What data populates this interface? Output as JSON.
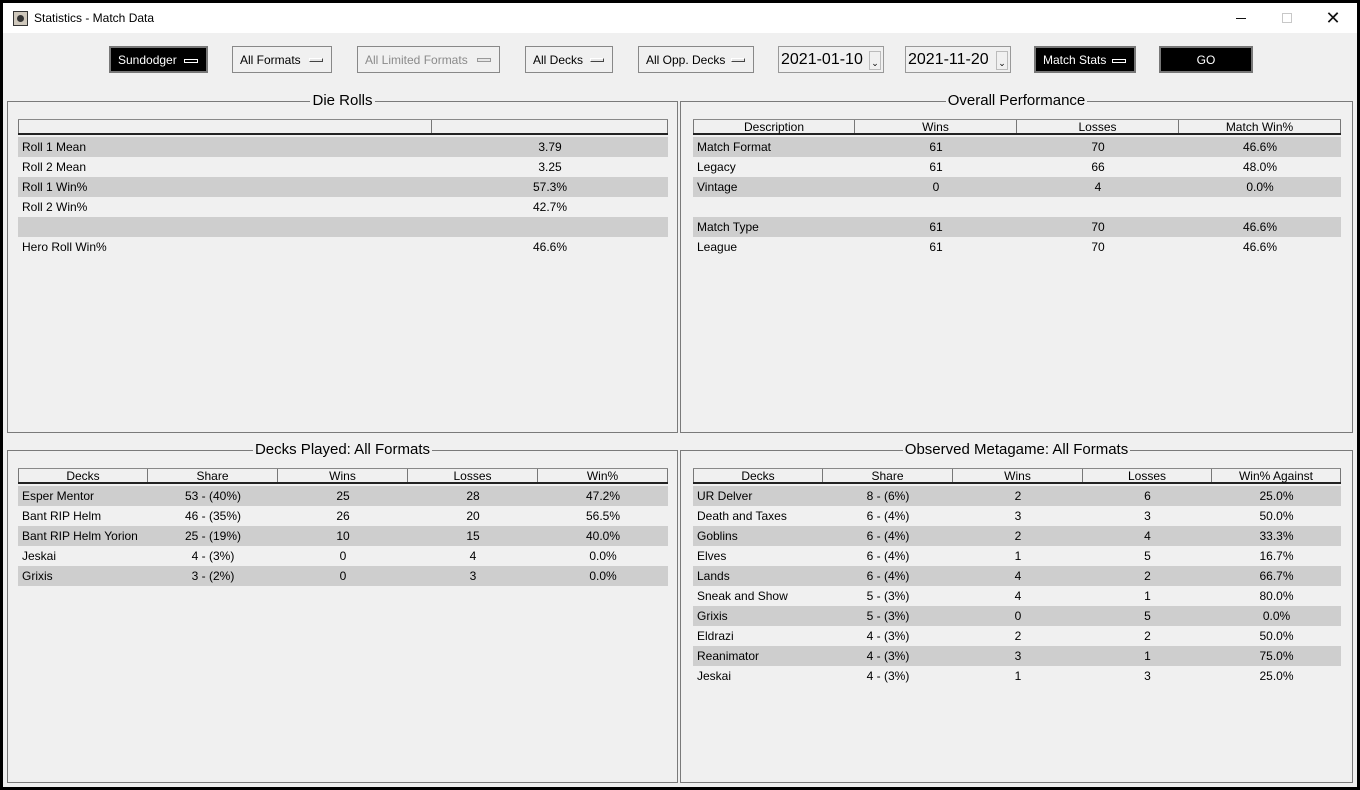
{
  "window": {
    "title": "Statistics - Match Data",
    "minimize_icon": "minimize-icon",
    "maximize_icon": "maximize-icon",
    "close_icon": "close-icon"
  },
  "toolbar": {
    "player": "Sundodger",
    "format": "All Formats",
    "limited_format": "All Limited Formats",
    "deck": "All Decks",
    "opp_deck": "All Opp. Decks",
    "date_from": "2021-01-10",
    "date_to": "2021-11-20",
    "date_arrow": "⌄",
    "stat_type": "Match Stats",
    "go_label": "GO"
  },
  "die_rolls": {
    "title": "Die Rolls",
    "headers": [
      "",
      ""
    ],
    "rows": [
      [
        "Roll 1 Mean",
        "3.79"
      ],
      [
        "Roll 2 Mean",
        "3.25"
      ],
      [
        "Roll 1 Win%",
        "57.3%"
      ],
      [
        "Roll 2 Win%",
        "42.7%"
      ],
      [
        "",
        ""
      ],
      [
        "Hero Roll Win%",
        "46.6%"
      ]
    ]
  },
  "overall": {
    "title": "Overall Performance",
    "headers": [
      "Description",
      "Wins",
      "Losses",
      "Match Win%"
    ],
    "rows": [
      [
        "Match Format",
        "61",
        "70",
        "46.6%"
      ],
      [
        "Legacy",
        "61",
        "66",
        "48.0%"
      ],
      [
        "Vintage",
        "0",
        "4",
        "0.0%"
      ],
      [
        "",
        "",
        "",
        ""
      ],
      [
        "Match Type",
        "61",
        "70",
        "46.6%"
      ],
      [
        "League",
        "61",
        "70",
        "46.6%"
      ]
    ]
  },
  "decks_played": {
    "title": "Decks Played: All Formats",
    "headers": [
      "Decks",
      "Share",
      "Wins",
      "Losses",
      "Win%"
    ],
    "rows": [
      [
        "Esper Mentor",
        "53 - (40%)",
        "25",
        "28",
        "47.2%"
      ],
      [
        "Bant RIP Helm",
        "46 - (35%)",
        "26",
        "20",
        "56.5%"
      ],
      [
        "Bant RIP Helm Yorion",
        "25 - (19%)",
        "10",
        "15",
        "40.0%"
      ],
      [
        "Jeskai",
        "4 - (3%)",
        "0",
        "4",
        "0.0%"
      ],
      [
        "Grixis",
        "3 - (2%)",
        "0",
        "3",
        "0.0%"
      ]
    ]
  },
  "metagame": {
    "title": "Observed Metagame: All Formats",
    "headers": [
      "Decks",
      "Share",
      "Wins",
      "Losses",
      "Win% Against"
    ],
    "rows": [
      [
        "UR Delver",
        "8 - (6%)",
        "2",
        "6",
        "25.0%"
      ],
      [
        "Death and Taxes",
        "6 - (4%)",
        "3",
        "3",
        "50.0%"
      ],
      [
        "Goblins",
        "6 - (4%)",
        "2",
        "4",
        "33.3%"
      ],
      [
        "Elves",
        "6 - (4%)",
        "1",
        "5",
        "16.7%"
      ],
      [
        "Lands",
        "6 - (4%)",
        "4",
        "2",
        "66.7%"
      ],
      [
        "Sneak and Show",
        "5 - (3%)",
        "4",
        "1",
        "80.0%"
      ],
      [
        "Grixis",
        "5 - (3%)",
        "0",
        "5",
        "0.0%"
      ],
      [
        "Eldrazi",
        "4 - (3%)",
        "2",
        "2",
        "50.0%"
      ],
      [
        "Reanimator",
        "4 - (3%)",
        "3",
        "1",
        "75.0%"
      ],
      [
        "Jeskai",
        "4 - (3%)",
        "1",
        "3",
        "25.0%"
      ]
    ]
  }
}
